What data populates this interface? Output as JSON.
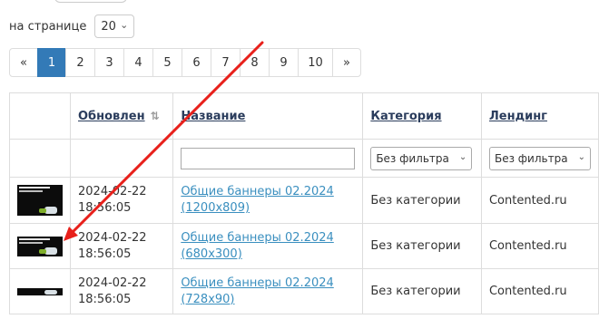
{
  "per_page": {
    "label": "на странице",
    "value": "20"
  },
  "pagination": [
    "«",
    "1",
    "2",
    "3",
    "4",
    "5",
    "6",
    "7",
    "8",
    "9",
    "10",
    "»"
  ],
  "pagination_active": "1",
  "table": {
    "headers": {
      "updated": "Обновлен",
      "name": "Название",
      "category": "Категория",
      "landing": "Лендинг"
    },
    "filters": {
      "category": "Без фильтра",
      "landing": "Без фильтра"
    },
    "rows": [
      {
        "date": "2024-02-22",
        "time": "18:56:05",
        "name": "Общие баннеры 02.2024",
        "size": "(1200x809)",
        "category": "Без категории",
        "landing": "Contented.ru"
      },
      {
        "date": "2024-02-22",
        "time": "18:56:05",
        "name": "Общие баннеры 02.2024",
        "size": "(680x300)",
        "category": "Без категории",
        "landing": "Contented.ru"
      },
      {
        "date": "2024-02-22",
        "time": "18:56:05",
        "name": "Общие баннеры 02.2024",
        "size": "(728x90)",
        "category": "Без категории",
        "landing": "Contented.ru"
      }
    ]
  },
  "icons": {
    "sort": "sort-icon",
    "caret": "chevron-down-icon"
  },
  "colors": {
    "active_page": "#337ab7",
    "link": "#3a8fbf",
    "annotation_arrow": "#e8201b"
  }
}
